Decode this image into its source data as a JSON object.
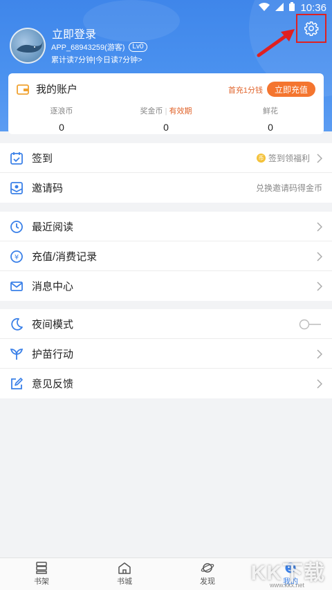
{
  "status_bar": {
    "time": "10:36"
  },
  "profile": {
    "login_title": "立即登录",
    "user_id": "APP_68943259(游客)",
    "level": "Lv0",
    "read_stats": "累计读7分钟|今日读7分钟>"
  },
  "account": {
    "title": "我的账户",
    "first_recharge_label": "首充1分钱",
    "recharge_button": "立即充值",
    "stats": [
      {
        "label": "逐浪币",
        "value": "0"
      },
      {
        "label": "奖金币",
        "label_extra": "有效期",
        "value": "0"
      },
      {
        "label": "鲜花",
        "value": "0"
      }
    ]
  },
  "menu_group1": {
    "checkin_label": "签到",
    "checkin_hint": "签到领福利",
    "invite_label": "邀请码",
    "invite_hint": "兑换邀请码得金币"
  },
  "menu_group2": {
    "recent_label": "最近阅读",
    "records_label": "充值/消费记录",
    "messages_label": "消息中心"
  },
  "menu_group3": {
    "night_label": "夜间模式",
    "night_mode_on": false,
    "seedling_label": "护苗行动",
    "feedback_label": "意见反馈"
  },
  "bottom_nav": {
    "items": [
      {
        "label": "书架"
      },
      {
        "label": "书城"
      },
      {
        "label": "发现"
      },
      {
        "label": "我的"
      }
    ],
    "active_index": 3
  },
  "watermark": {
    "text": "KK下载",
    "sub": "www.kkx.net"
  },
  "colors": {
    "header_blue": "#4a91ef",
    "accent_orange": "#f4752f",
    "icon_blue": "#3a80e8",
    "highlight_red": "#e02020"
  }
}
